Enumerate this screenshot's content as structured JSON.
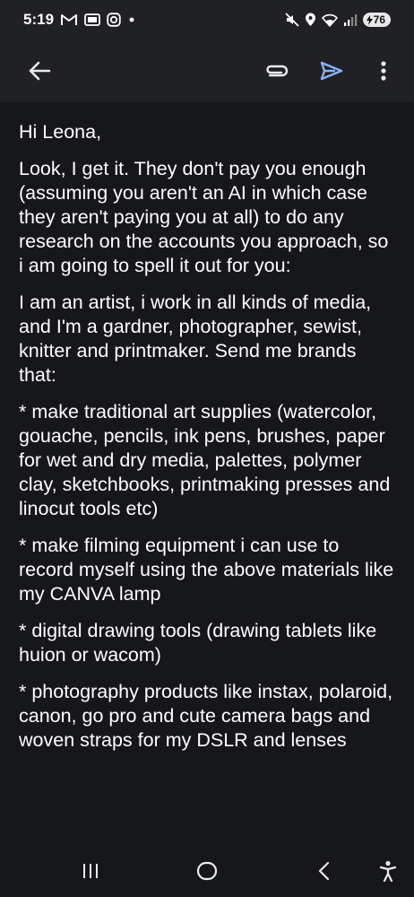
{
  "status_bar": {
    "time": "5:19",
    "battery": "76",
    "left_icons": [
      "gmail-icon",
      "sim-card-icon",
      "instagram-icon",
      "dot-icon"
    ],
    "right_icons": [
      "mute-icon",
      "location-icon",
      "wifi-icon",
      "signal-icon"
    ]
  },
  "toolbar": {
    "icons": [
      "back-arrow-icon",
      "attachment-icon",
      "send-icon",
      "more-vert-icon"
    ],
    "accent_color": "#8ab4f8"
  },
  "email": {
    "paragraphs": [
      "Hi Leona,",
      "Look, I get it. They don't pay you enough (assuming you aren't an AI in which case they aren't paying you at all) to do any research on the accounts you approach, so i am going to spell it out for you:",
      "I am an artist, i work in all kinds of media, and I'm a gardner, photographer, sewist, knitter and printmaker. Send me brands that:",
      "* make traditional art supplies (watercolor, gouache, pencils, ink pens, brushes, paper for wet and dry media, palettes, polymer clay, sketchbooks, printmaking presses and linocut tools etc)",
      "* make filming equipment i can use to record myself using the above materials like my CANVA lamp",
      "* digital drawing tools (drawing tablets like huion or wacom)",
      "* photography products like instax, polaroid, canon, go pro and cute camera bags and woven straps for my DSLR and lenses"
    ]
  },
  "nav_bar": {
    "icons": [
      "recent-apps-icon",
      "home-icon",
      "back-icon",
      "accessibility-icon"
    ]
  }
}
